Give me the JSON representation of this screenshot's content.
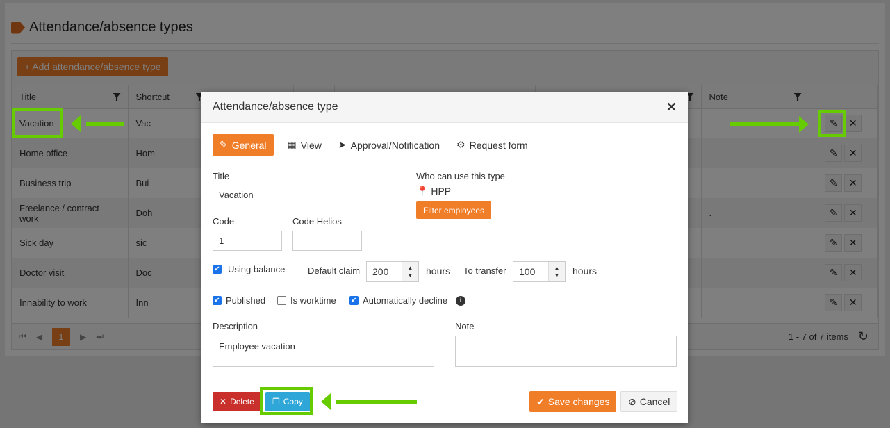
{
  "page": {
    "title": "Attendance/absence types",
    "add_button": "Add attendance/absence type"
  },
  "grid": {
    "columns": [
      "Title",
      "Shortcut",
      "",
      "",
      "",
      "",
      "",
      "Note",
      ""
    ],
    "rows": [
      {
        "title": "Vacation",
        "shortcut": "Vac",
        "note": ""
      },
      {
        "title": "Home office",
        "shortcut": "Hom",
        "note": ""
      },
      {
        "title": "Business trip",
        "shortcut": "Bui",
        "note": ""
      },
      {
        "title": "Freelance / contract work",
        "shortcut": "Doh",
        "note": "."
      },
      {
        "title": "Sick day",
        "shortcut": "sic",
        "note": ""
      },
      {
        "title": "Doctor visit",
        "shortcut": "Doc",
        "note": ""
      },
      {
        "title": "Innability to work",
        "shortcut": "Inn",
        "note": ""
      }
    ],
    "pager": {
      "current_page": "1",
      "info": "1 - 7 of 7 items"
    }
  },
  "modal": {
    "title": "Attendance/absence type",
    "tabs": [
      "General",
      "View",
      "Approval/Notification",
      "Request form"
    ],
    "title_label": "Title",
    "title_value": "Vacation",
    "who_label": "Who can use this type",
    "who_value": "HPP",
    "filter_button": "Filter employees",
    "code_label": "Code",
    "code_value": "1",
    "code_helios_label": "Code Helios",
    "code_helios_value": "",
    "using_balance": "Using balance",
    "default_claim_label": "Default claim",
    "default_claim_value": "200",
    "hours": "hours",
    "to_transfer_label": "To transfer",
    "to_transfer_value": "100",
    "published": "Published",
    "is_worktime": "Is worktime",
    "auto_decline": "Automatically decline",
    "description_label": "Description",
    "description_value": "Employee vacation",
    "note_label": "Note",
    "note_value": "",
    "delete": "Delete",
    "copy": "Copy",
    "save": "Save changes",
    "cancel": "Cancel"
  }
}
